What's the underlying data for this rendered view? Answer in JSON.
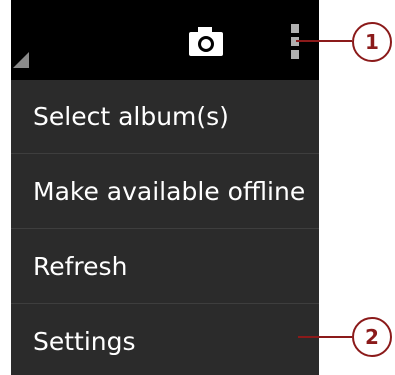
{
  "action_bar": {
    "camera_icon": "camera-icon",
    "overflow_icon": "overflow-menu-icon"
  },
  "menu": {
    "items": [
      {
        "label": "Select album(s)"
      },
      {
        "label": "Make available offline"
      },
      {
        "label": "Refresh"
      },
      {
        "label": "Settings"
      }
    ]
  },
  "callouts": [
    {
      "number": "1"
    },
    {
      "number": "2"
    }
  ],
  "colors": {
    "callout": "#8b1a1a",
    "menu_bg": "#2b2b2b",
    "action_bar_bg": "#000000",
    "text": "#ffffff"
  }
}
